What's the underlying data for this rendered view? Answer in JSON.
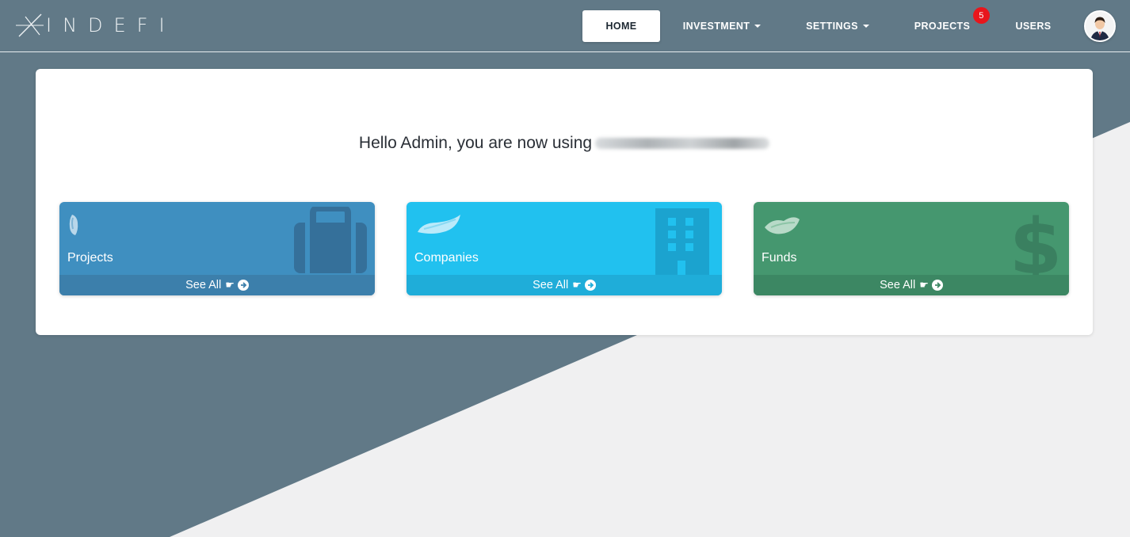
{
  "app": {
    "logo_text": "INDEFI"
  },
  "nav": {
    "items": [
      {
        "label": "HOME",
        "active": true,
        "dropdown": false
      },
      {
        "label": "INVESTMENT",
        "active": false,
        "dropdown": true
      },
      {
        "label": "SETTINGS",
        "active": false,
        "dropdown": true
      },
      {
        "label": "PROJECTS",
        "active": false,
        "dropdown": false,
        "badge": "5"
      },
      {
        "label": "USERS",
        "active": false,
        "dropdown": false
      }
    ],
    "avatar_icon": "user-avatar-icon"
  },
  "main": {
    "greeting": "Hello Admin, you are now using"
  },
  "cards": [
    {
      "title": "Projects",
      "link_label": "See All",
      "hand_icon": "☛",
      "icon": "briefcase-icon",
      "color": "#3f8fc0",
      "footer_color": "#3c7fab",
      "icon_color": "#35709a"
    },
    {
      "title": "Companies",
      "link_label": "See All",
      "hand_icon": "☛",
      "icon": "building-icon",
      "color": "#21c1ef",
      "footer_color": "#1fadd9",
      "icon_color": "#1ba3cf"
    },
    {
      "title": "Funds",
      "link_label": "See All",
      "hand_icon": "☛",
      "icon": "dollar-icon",
      "color": "#45976f",
      "footer_color": "#3c8763",
      "icon_color": "#3a8060"
    }
  ],
  "colors": {
    "background_dark": "#617987",
    "background_light": "#f0f0f1",
    "badge": "#e8161c"
  }
}
